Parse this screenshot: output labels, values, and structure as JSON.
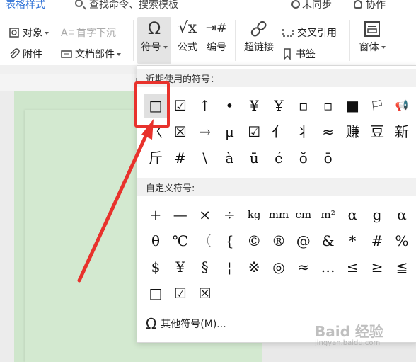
{
  "topbar": {
    "tab_label": "表格样式",
    "search_text": "查找命令、搜索模板",
    "sync_label": "未同步",
    "collab_label": "协作"
  },
  "ribbon": {
    "object_label": "对象",
    "dropcap_label": "首字下沉",
    "attachment_label": "附件",
    "docpart_label": "文档部件",
    "symbol_label": "符号",
    "formula_label": "公式",
    "numbering_label": "编号",
    "hyperlink_label": "超链接",
    "crossref_label": "交叉引用",
    "bookmark_label": "书签",
    "window_label": "窗体"
  },
  "panel": {
    "recent_title": "近期使用的符号：",
    "recent_symbols": [
      "□",
      "☑",
      "↑",
      "•",
      "¥",
      "Ұ",
      "▫",
      "▫",
      "■",
      "🏳",
      "📢",
      "〈",
      "☒",
      "→",
      "μ",
      "☑",
      "亻",
      "丬",
      "≈",
      "赚",
      "豆",
      "新",
      "斤",
      "#",
      "\\",
      "à",
      "ū",
      "é",
      "ŏ",
      "ō"
    ],
    "custom_title": "自定义符号:",
    "custom_symbols": [
      "+",
      "—",
      "×",
      "÷",
      "kg",
      "mm",
      "cm",
      "m²",
      "α",
      "g",
      "α",
      "θ",
      "℃",
      "〖",
      "{",
      "©",
      "®",
      "@",
      "&",
      "*",
      "#",
      "%",
      "$",
      "¥",
      "§",
      "¦",
      "※",
      "◎",
      "≈",
      "…",
      "≤",
      "≥",
      "≦",
      "□",
      "☑",
      "☒"
    ],
    "more_label": "其他符号(M)..."
  },
  "watermark": {
    "brand": "Baid 经验",
    "sub": "jingyan.baidu.com"
  },
  "colors": {
    "highlight": "#e8322c",
    "doc_bg": "#cfe6cc",
    "accent": "#2b6fd6"
  }
}
